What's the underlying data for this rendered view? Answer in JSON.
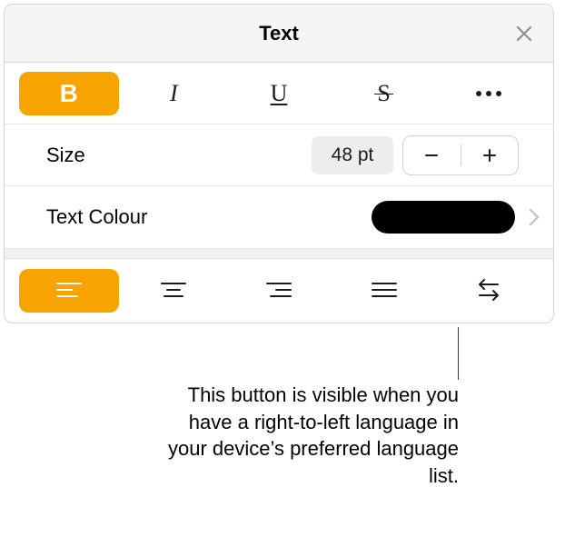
{
  "header": {
    "title": "Text"
  },
  "styles": {
    "bold_glyph": "B",
    "italic_glyph": "I",
    "underline_glyph": "U",
    "strike_glyph": "S"
  },
  "size": {
    "label": "Size",
    "value": "48 pt"
  },
  "colour": {
    "label": "Text Colour",
    "value_hex": "#000000"
  },
  "accent_hex": "#f7a400",
  "callout_text": "This button is visible when you have a right-to-left language in your device’s preferred language list."
}
